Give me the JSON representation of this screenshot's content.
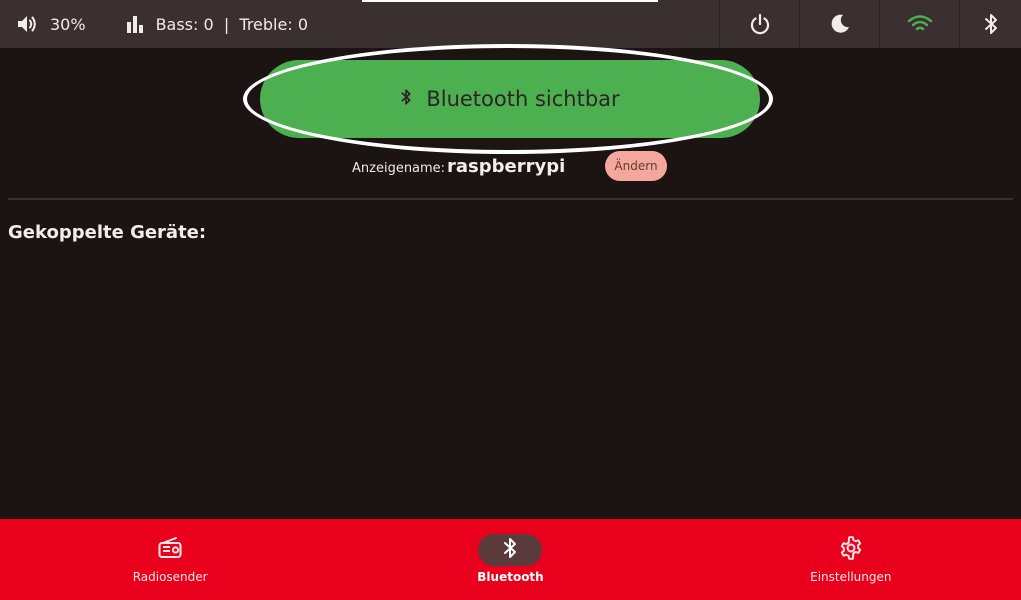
{
  "status": {
    "volume": "30%",
    "equalizer": "Bass: 0  |  Treble: 0"
  },
  "quick_actions": [
    {
      "name": "power",
      "icon": "power-icon"
    },
    {
      "name": "sleep",
      "icon": "moon-icon"
    },
    {
      "name": "wifi",
      "icon": "wifi-icon",
      "color": "#4caf50"
    },
    {
      "name": "bluetooth",
      "icon": "bluetooth-icon"
    }
  ],
  "bluetooth": {
    "visible_label": "Bluetooth sichtbar",
    "display_name_label": "Anzeigename:",
    "display_name": "raspberrypi",
    "change_label": "Ändern",
    "paired_title": "Gekoppelte Geräte:"
  },
  "nav": [
    {
      "label": "Radiosender",
      "icon": "radio-icon"
    },
    {
      "label": "Bluetooth",
      "icon": "bluetooth-icon",
      "active": true
    },
    {
      "label": "Einstellungen",
      "icon": "gear-icon"
    }
  ],
  "colors": {
    "accent_green": "#4caf50",
    "nav_red": "#e8001c",
    "change_button": "#f4a79c"
  }
}
